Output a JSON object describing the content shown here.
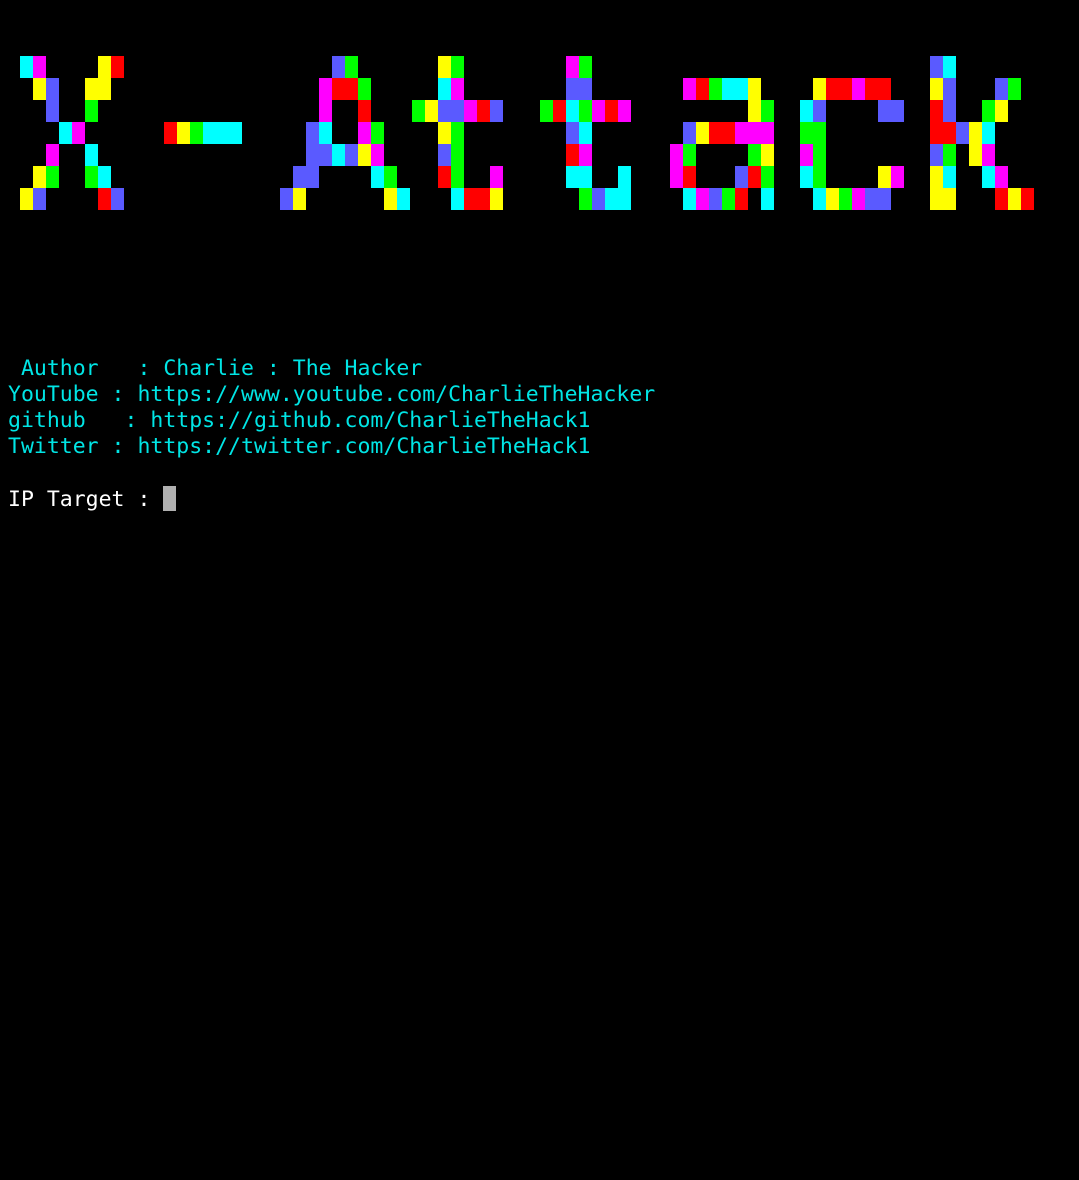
{
  "banner": {
    "text": "X-Attack",
    "palette": [
      "#ff0000",
      "#ffff00",
      "#00ff00",
      "#00ffff",
      "#5a5aff",
      "#ff00ff"
    ]
  },
  "info": {
    "author": " Author   : Charlie : The Hacker",
    "youtube": "YouTube : https://www.youtube.com/CharlieTheHacker",
    "github": "github   : https://github.com/CharlieTheHack1",
    "twitter": "Twitter : https://twitter.com/CharlieTheHack1"
  },
  "prompt": {
    "label": "IP Target : ",
    "value": ""
  },
  "colors": {
    "background": "#000000",
    "info_text": "#00e5e5",
    "prompt_text": "#ffffff",
    "cursor": "#b0b0b0"
  }
}
